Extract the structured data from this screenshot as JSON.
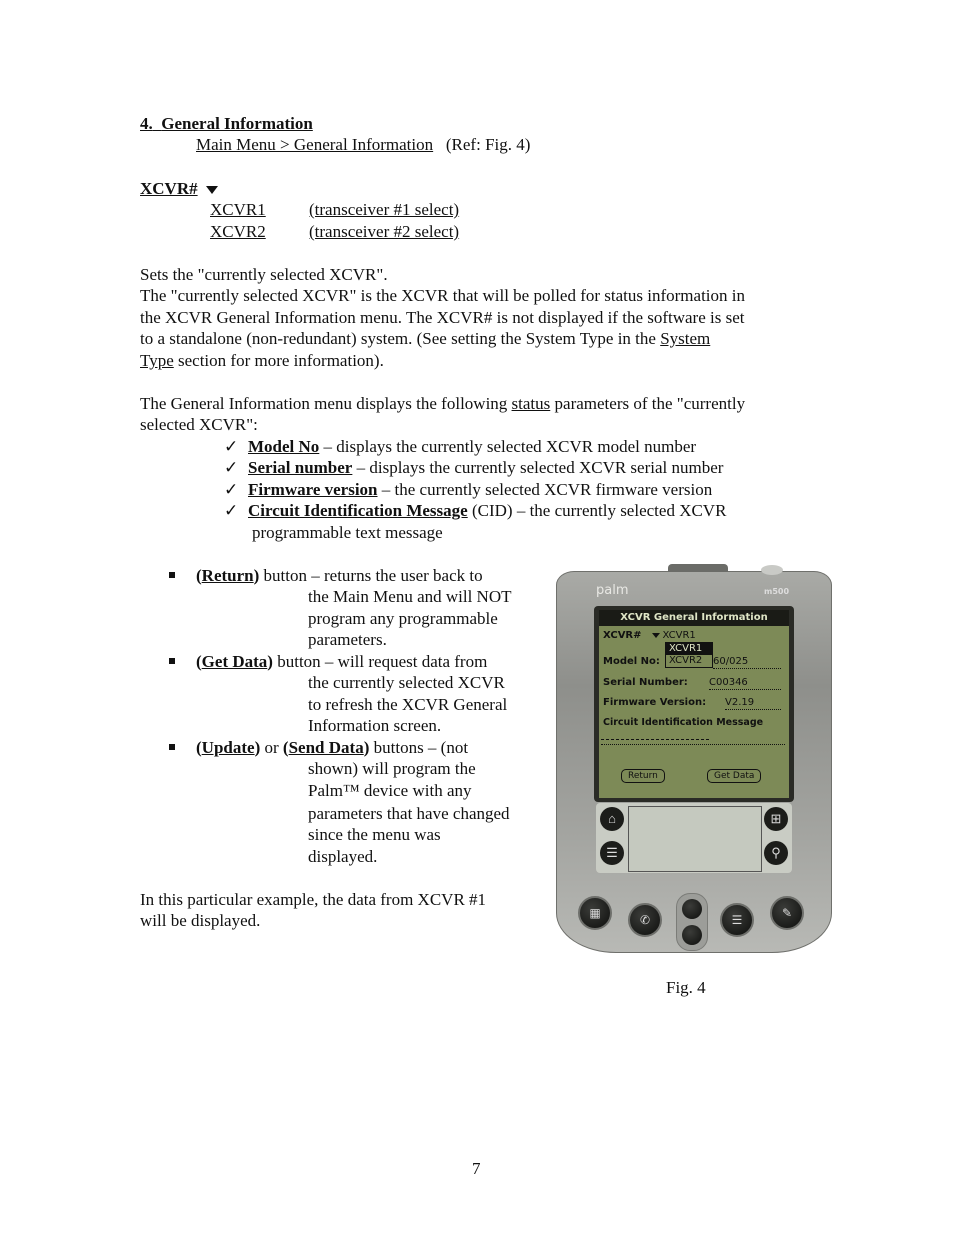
{
  "section": {
    "number": "4.",
    "title": "General Information",
    "nav_path": "Main Menu > General Information",
    "ref": "(Ref: Fig. 4)"
  },
  "xcvr_field": {
    "label": "XCVR#",
    "icon": "dropdown-triangle-icon",
    "options": [
      {
        "value": "XCVR1",
        "desc": "(transceiver #1 select)"
      },
      {
        "value": "XCVR2",
        "desc": "(transceiver #2 select)"
      }
    ]
  },
  "para1": {
    "line1": "Sets the \"currently selected XCVR\".",
    "line2": "The \"currently selected XCVR\" is the XCVR that will be polled for status information in",
    "line3": "the XCVR General Information menu.  The XCVR# is not displayed if the software is set",
    "line4_pre": "to a standalone (non-redundant) system.  (See setting the System Type in the ",
    "line4_link": "System",
    "line5_link": "Type",
    "line5_post": " section for more information)."
  },
  "para2": {
    "pre": "The General Information menu displays the following ",
    "link": "status",
    "post": " parameters of the \"currently",
    "line2": "selected XCVR\":"
  },
  "checklist": [
    {
      "term": "Model No",
      "desc": " – displays the currently selected XCVR model number"
    },
    {
      "term": "Serial number",
      "desc": " – displays the currently selected XCVR serial number"
    },
    {
      "term": "Firmware version",
      "desc": " – the currently selected XCVR firmware version"
    },
    {
      "term": "Circuit Identification Message",
      "desc": " (CID) – the currently selected XCVR",
      "desc2": "programmable text message"
    }
  ],
  "check_icon": "✓",
  "buttons_list": [
    {
      "term": "Return",
      "lead": " button – returns the user back to",
      "lines": [
        "the Main Menu and will NOT",
        "program any programmable",
        "parameters."
      ]
    },
    {
      "term": "Get Data",
      "lead": " button – will request data from",
      "lines": [
        "the currently selected XCVR",
        "to refresh the XCVR General",
        "Information screen."
      ]
    },
    {
      "term": "Update",
      "mid": " or ",
      "term2": "Send Data",
      "lead": " buttons – (not",
      "lines": [
        "shown) will program the",
        "Palm™ device with any",
        "parameters that have changed",
        "since the menu was",
        "displayed."
      ]
    }
  ],
  "example": {
    "line1": "In this particular example, the data from XCVR #1",
    "line2": "will be displayed."
  },
  "figure": {
    "caption": "Fig. 4",
    "device": {
      "brand": "palm",
      "model": "m500",
      "screen": {
        "title": "XCVR General Information",
        "xcvr_label": "XCVR#",
        "xcvr_selected": "XCVR1",
        "popup_options": [
          "XCVR1",
          "XCVR2"
        ],
        "model_label": "Model No:",
        "model_value": "60/025",
        "serial_label": "Serial Number:",
        "serial_value": "C00346",
        "firmware_label": "Firmware Version:",
        "firmware_value": "V2.19",
        "cid_label": "Circuit Identification Message",
        "cid_value": "------------------------",
        "return_button": "Return",
        "getdata_button": "Get Data"
      },
      "silkscreen_icons": [
        "home-icon",
        "menu-icon",
        "applications-icon",
        "find-icon"
      ],
      "hardware_buttons": [
        "date-book-icon",
        "address-book-icon",
        "scroll-up",
        "scroll-down",
        "todo-icon",
        "memo-pad-icon"
      ],
      "screen_color": "#7d8a57"
    }
  },
  "page_number": "7"
}
